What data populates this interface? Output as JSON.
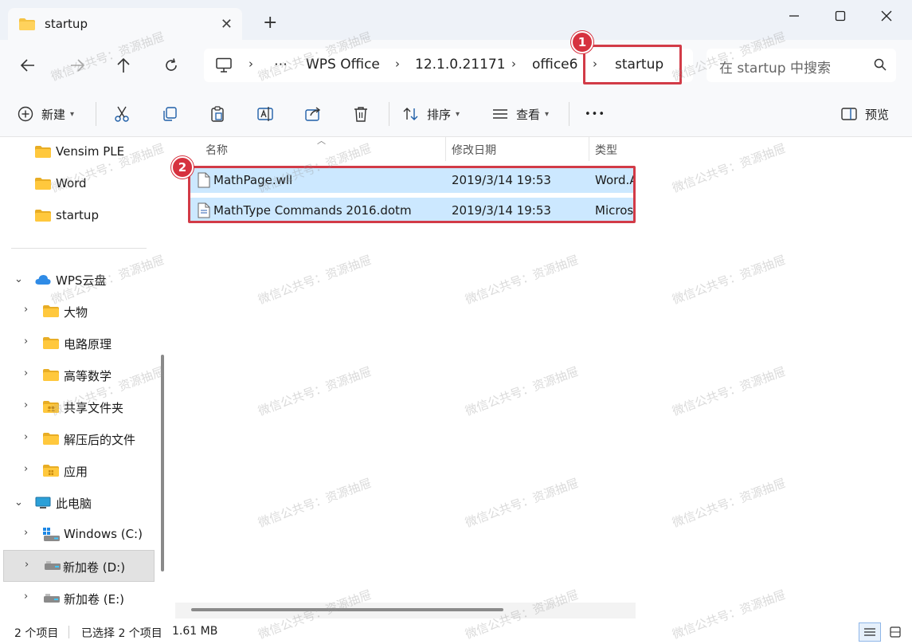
{
  "window": {
    "tab_title": "startup",
    "new_tab": "+",
    "close_tab": "✕"
  },
  "breadcrumb": {
    "ellipsis": "⋯",
    "items": [
      "WPS Office",
      "12.1.0.21171",
      "office6",
      "startup"
    ]
  },
  "search": {
    "placeholder": "在 startup 中搜索"
  },
  "toolbar": {
    "new_label": "新建",
    "sort_label": "排序",
    "view_label": "查看",
    "more_label": "•••",
    "preview_label": "预览"
  },
  "sidebar": {
    "items": [
      {
        "label": "Vensim PLE"
      },
      {
        "label": "Word"
      },
      {
        "label": "startup"
      },
      {
        "label": "WPS云盘"
      },
      {
        "label": "大物"
      },
      {
        "label": "电路原理"
      },
      {
        "label": "高等数学"
      },
      {
        "label": "共享文件夹"
      },
      {
        "label": "解压后的文件"
      },
      {
        "label": "应用"
      },
      {
        "label": "此电脑"
      },
      {
        "label": "Windows (C:)"
      },
      {
        "label": "新加卷 (D:)"
      },
      {
        "label": "新加卷 (E:)"
      }
    ]
  },
  "columns": {
    "name": "名称",
    "modified": "修改日期",
    "type": "类型"
  },
  "files": [
    {
      "name": "MathPage.wll",
      "modified": "2019/3/14 19:53",
      "type": "Word.Addin"
    },
    {
      "name": "MathType Commands 2016.dotm",
      "modified": "2019/3/14 19:53",
      "type": "Microsoft"
    }
  ],
  "annotations": {
    "badge1": "1",
    "badge2": "2"
  },
  "status": {
    "item_count": "2 个项目",
    "selected": "已选择 2 个项目",
    "size": "1.61 MB"
  },
  "watermark": "微信公共号：资源抽屉",
  "colors": {
    "highlight": "#d23b47",
    "selection": "#cce8ff",
    "folder": "#f5c242"
  }
}
